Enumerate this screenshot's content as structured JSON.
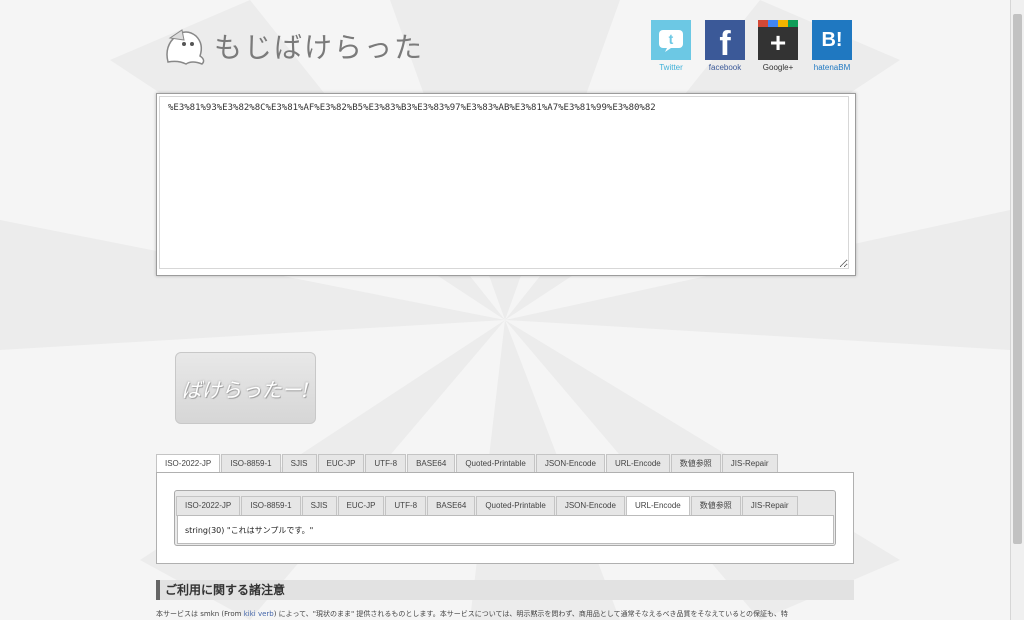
{
  "logo": {
    "text": "もじばけらった"
  },
  "social": [
    {
      "name": "twitter",
      "caption": "Twitter",
      "color": "#5fc2e0"
    },
    {
      "name": "facebook",
      "caption": "facebook",
      "color": "#3b5998"
    },
    {
      "name": "google-plus",
      "caption": "Google+",
      "color": "#333333"
    },
    {
      "name": "hatena",
      "caption": "hatenaBM",
      "color": "#1f78c1"
    }
  ],
  "input": {
    "value": "%E3%81%93%E3%82%8C%E3%81%AF%E3%82%B5%E3%83%B3%E3%83%97%E3%83%AB%E3%81%A7%E3%81%99%E3%80%82"
  },
  "convert_button": {
    "label": "ばけらったー!"
  },
  "tabs_outer": [
    "ISO-2022-JP",
    "ISO-8859-1",
    "SJIS",
    "EUC-JP",
    "UTF-8",
    "BASE64",
    "Quoted-Printable",
    "JSON-Encode",
    "URL-Encode",
    "数値参照",
    "JIS-Repair"
  ],
  "tabs_inner": [
    "ISO-2022-JP",
    "ISO-8859-1",
    "SJIS",
    "EUC-JP",
    "UTF-8",
    "BASE64",
    "Quoted-Printable",
    "JSON-Encode",
    "URL-Encode",
    "数値参照",
    "JIS-Repair"
  ],
  "active_outer": "ISO-2022-JP",
  "active_inner": "URL-Encode",
  "result": {
    "text": "string(30) \"これはサンプルです。\""
  },
  "notice": {
    "heading": "ご利用に関する諸注意",
    "body_pre": "本サービスは smkn (From ",
    "link": "kiki verb",
    "body_post": ") によって、\"現状のまま\" 提供されるものとします。本サービスについては、明示黙示を問わず、商用品として通常そなえるべき品質をそなえているとの保証も、特"
  }
}
